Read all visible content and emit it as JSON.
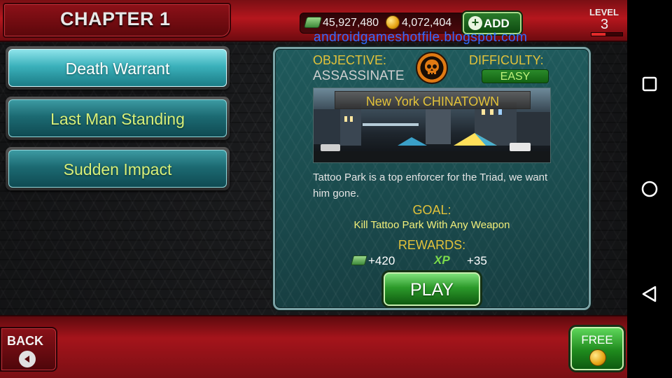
{
  "header": {
    "chapter_title": "CHAPTER 1",
    "cash": "45,927,480",
    "gold": "4,072,404",
    "add_label": "ADD",
    "watermark": "androidgameshotfile.blogspot.com",
    "level_label": "LEVEL",
    "level_value": "3",
    "level_progress_fraction": 0.45
  },
  "missions": [
    {
      "label": "Death Warrant",
      "active": true
    },
    {
      "label": "Last Man Standing",
      "active": false
    },
    {
      "label": "Sudden Impact",
      "active": false
    }
  ],
  "details": {
    "objective_label": "OBJECTIVE:",
    "objective_value": "ASSASSINATE",
    "difficulty_label": "DIFFICULTY:",
    "difficulty_value": "EASY",
    "location": "New York CHINATOWN",
    "description": "Tattoo Park is a top enforcer for the Triad, we want him gone.",
    "goal_label": "GOAL:",
    "goal_text": "Kill Tattoo Park With Any Weapon",
    "rewards_label": "REWARDS:",
    "reward_cash": "+420",
    "reward_xp_icon": "XP",
    "reward_xp": "+35",
    "play_label": "PLAY"
  },
  "footer": {
    "back_label": "BACK",
    "free_label": "FREE"
  },
  "icons": {
    "objective": "skull-icon",
    "nav_recents": "square-icon",
    "nav_home": "circle-icon",
    "nav_back": "triangle-back-icon"
  },
  "colors": {
    "accent_gold": "#e2c23a",
    "brand_red": "#b5161d",
    "play_green": "#2c9a2a",
    "easy_green": "#bff27a"
  }
}
